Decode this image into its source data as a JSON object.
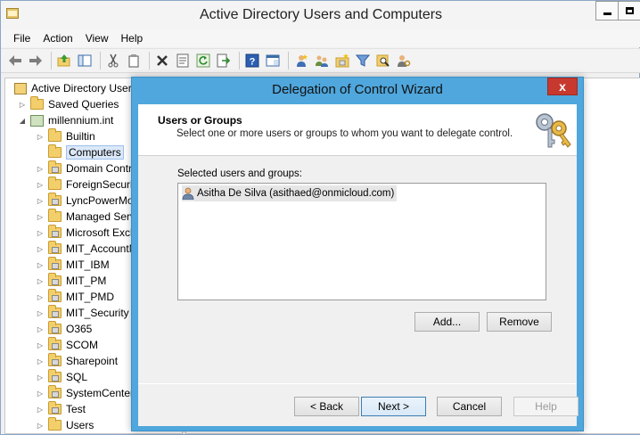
{
  "window": {
    "title": "Active Directory Users and Computers",
    "min_glyph": "–",
    "max_glyph": "□"
  },
  "menu": [
    "File",
    "Action",
    "View",
    "Help"
  ],
  "toolbar": {
    "icons": [
      "back-arrow-icon",
      "forward-arrow-icon",
      "up-folder-icon",
      "console-tree-icon",
      "cut-icon",
      "copy-icon",
      "delete-icon",
      "properties-icon",
      "refresh-icon",
      "export-icon",
      "help-icon",
      "console-icon",
      "new-user-icon",
      "new-group-icon",
      "new-ou-icon",
      "filter-icon",
      "find-icon",
      "delegate-icon"
    ]
  },
  "tree": {
    "root": "Active Directory Users",
    "saved_queries": "Saved Queries",
    "domain": "millennium.int",
    "items": [
      {
        "label": "Builtin",
        "type": "folder"
      },
      {
        "label": "Computers",
        "type": "folder"
      },
      {
        "label": "Domain Contr",
        "type": "ou"
      },
      {
        "label": "ForeignSecurit",
        "type": "folder"
      },
      {
        "label": "LyncPowerMo",
        "type": "ou"
      },
      {
        "label": "Managed Serv",
        "type": "folder"
      },
      {
        "label": "Microsoft Exch",
        "type": "ou"
      },
      {
        "label": "MIT_AccountM",
        "type": "ou"
      },
      {
        "label": "MIT_IBM",
        "type": "ou"
      },
      {
        "label": "MIT_PM",
        "type": "ou"
      },
      {
        "label": "MIT_PMD",
        "type": "ou"
      },
      {
        "label": "MIT_Security",
        "type": "ou"
      },
      {
        "label": "O365",
        "type": "ou"
      },
      {
        "label": "SCOM",
        "type": "ou"
      },
      {
        "label": "Sharepoint",
        "type": "ou"
      },
      {
        "label": "SQL",
        "type": "ou"
      },
      {
        "label": "SystemCenter",
        "type": "ou"
      },
      {
        "label": "Test",
        "type": "ou"
      },
      {
        "label": "Users",
        "type": "folder"
      }
    ]
  },
  "dialog": {
    "title": "Delegation of Control Wizard",
    "close_glyph": "x",
    "header_title": "Users or Groups",
    "header_subtitle": "Select one or more users or groups to whom you want to delegate control.",
    "list_label": "Selected users and groups:",
    "entries": [
      "Asitha De Silva (asithaed@onmicloud.com)"
    ],
    "add_label": "Add...",
    "remove_label": "Remove",
    "back_label": "< Back",
    "next_label": "Next >",
    "cancel_label": "Cancel",
    "help_label": "Help"
  }
}
